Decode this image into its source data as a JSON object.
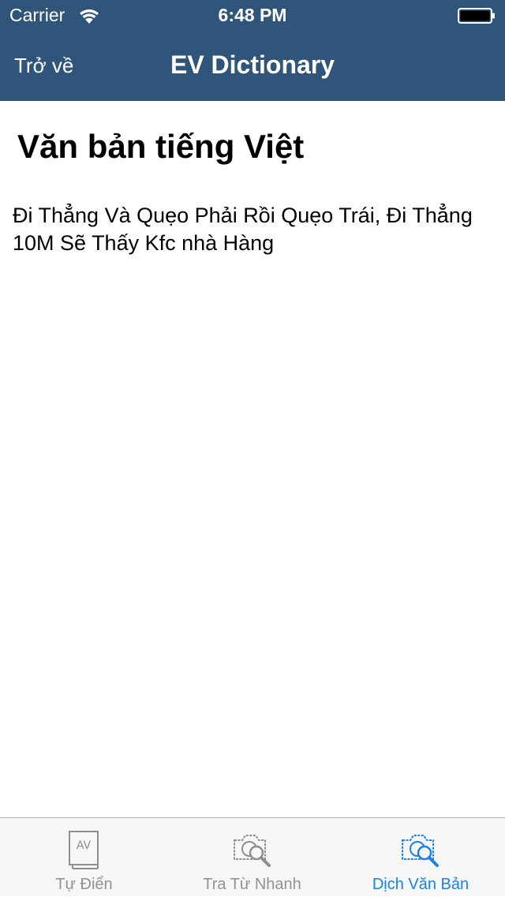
{
  "status_bar": {
    "carrier": "Carrier",
    "time": "6:48 PM",
    "wifi_icon": "wifi-icon",
    "battery_icon": "battery-icon"
  },
  "nav_bar": {
    "back_label": "Trở về",
    "title": "EV Dictionary"
  },
  "main": {
    "section_title": "Văn bản tiếng Việt",
    "text": "Đi Thẳng Và Quẹo Phải Rồi Quẹo Trái, Đi Thẳng 10M Sẽ Thấy Kfc nhà Hàng"
  },
  "tab_bar": {
    "items": [
      {
        "label": "Tự Điển",
        "icon": "dictionary-book-icon",
        "active": false
      },
      {
        "label": "Tra Từ Nhanh",
        "icon": "camera-search-icon",
        "active": false
      },
      {
        "label": "Dịch Văn Bản",
        "icon": "camera-search-icon",
        "active": true
      }
    ]
  },
  "colors": {
    "header_bg": "#2e5479",
    "active_tab": "#1a82e6",
    "inactive_tab": "#929292"
  }
}
